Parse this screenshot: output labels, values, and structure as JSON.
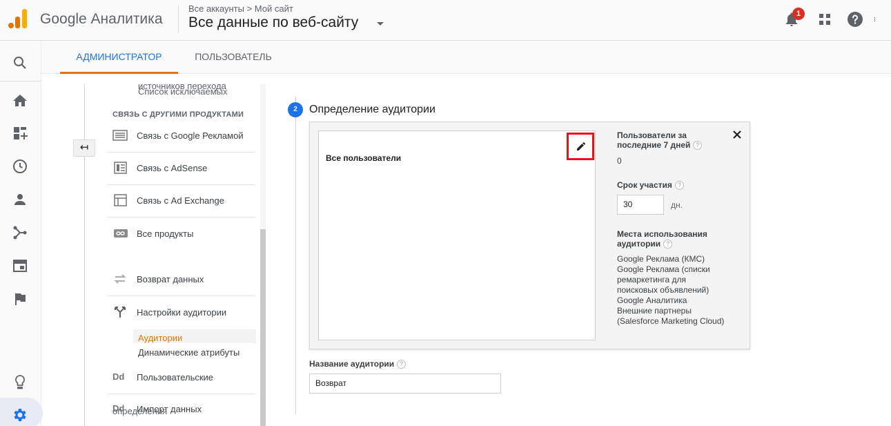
{
  "header": {
    "brand": "Google Аналитика",
    "breadcrumb": "Все аккаунты > Мой сайт",
    "property": "Все данные по веб-сайту",
    "notification_count": "1"
  },
  "tabs": [
    {
      "label": "АДМИНИСТРАТОР",
      "active": true
    },
    {
      "label": "ПОЛЬЗОВАТЕЛЬ",
      "active": false
    }
  ],
  "left_nav": {
    "cut_top_1": "источников перехода",
    "cut_top_2": "Список исключаемых",
    "section_title": "СВЯЗЬ С ДРУГИМИ ПРОДУКТАМИ",
    "items": [
      {
        "label": "Связь с Google Рекламой",
        "icon": "google-ads-icon"
      },
      {
        "label": "Связь с AdSense",
        "icon": "adsense-icon"
      },
      {
        "label": "Связь с Ad Exchange",
        "icon": "ad-exchange-icon"
      },
      {
        "label": "Все продукты",
        "icon": "link-icon"
      },
      {
        "label": "Возврат данных",
        "icon": "data-return-icon"
      },
      {
        "label": "Настройки аудитории",
        "icon": "audience-fork-icon"
      }
    ],
    "sub_items": [
      {
        "label": "Аудитории",
        "active": true
      },
      {
        "label": "Динамические атрибуты",
        "active": false
      }
    ],
    "items_after": [
      {
        "label": "Пользовательские",
        "icon": "dd-icon"
      },
      {
        "label": "Импорт данных",
        "icon": "dd-icon"
      }
    ],
    "cut_bottom": "определения"
  },
  "step": {
    "number": "2",
    "title": "Определение аудитории"
  },
  "definition": {
    "segment_name": "Все пользователи",
    "users_label": "Пользователи за последние 7 дней",
    "users_value": "0",
    "duration_label": "Срок участия",
    "duration_value": "30",
    "duration_unit": "дн.",
    "destinations_label": "Места использования аудитории",
    "destinations": [
      "Google Реклама (КМС)",
      "Google Реклама (списки",
      "ремаркетинга для",
      "поисковых объявлений)",
      "Google Аналитика",
      "Внешние партнеры",
      "(Salesforce Marketing Cloud)"
    ]
  },
  "audience_name": {
    "label": "Название аудитории",
    "value": "Возврат"
  },
  "colors": {
    "accent_blue": "#1a73e8",
    "accent_orange": "#e37400",
    "highlight_red": "#e8101a"
  }
}
